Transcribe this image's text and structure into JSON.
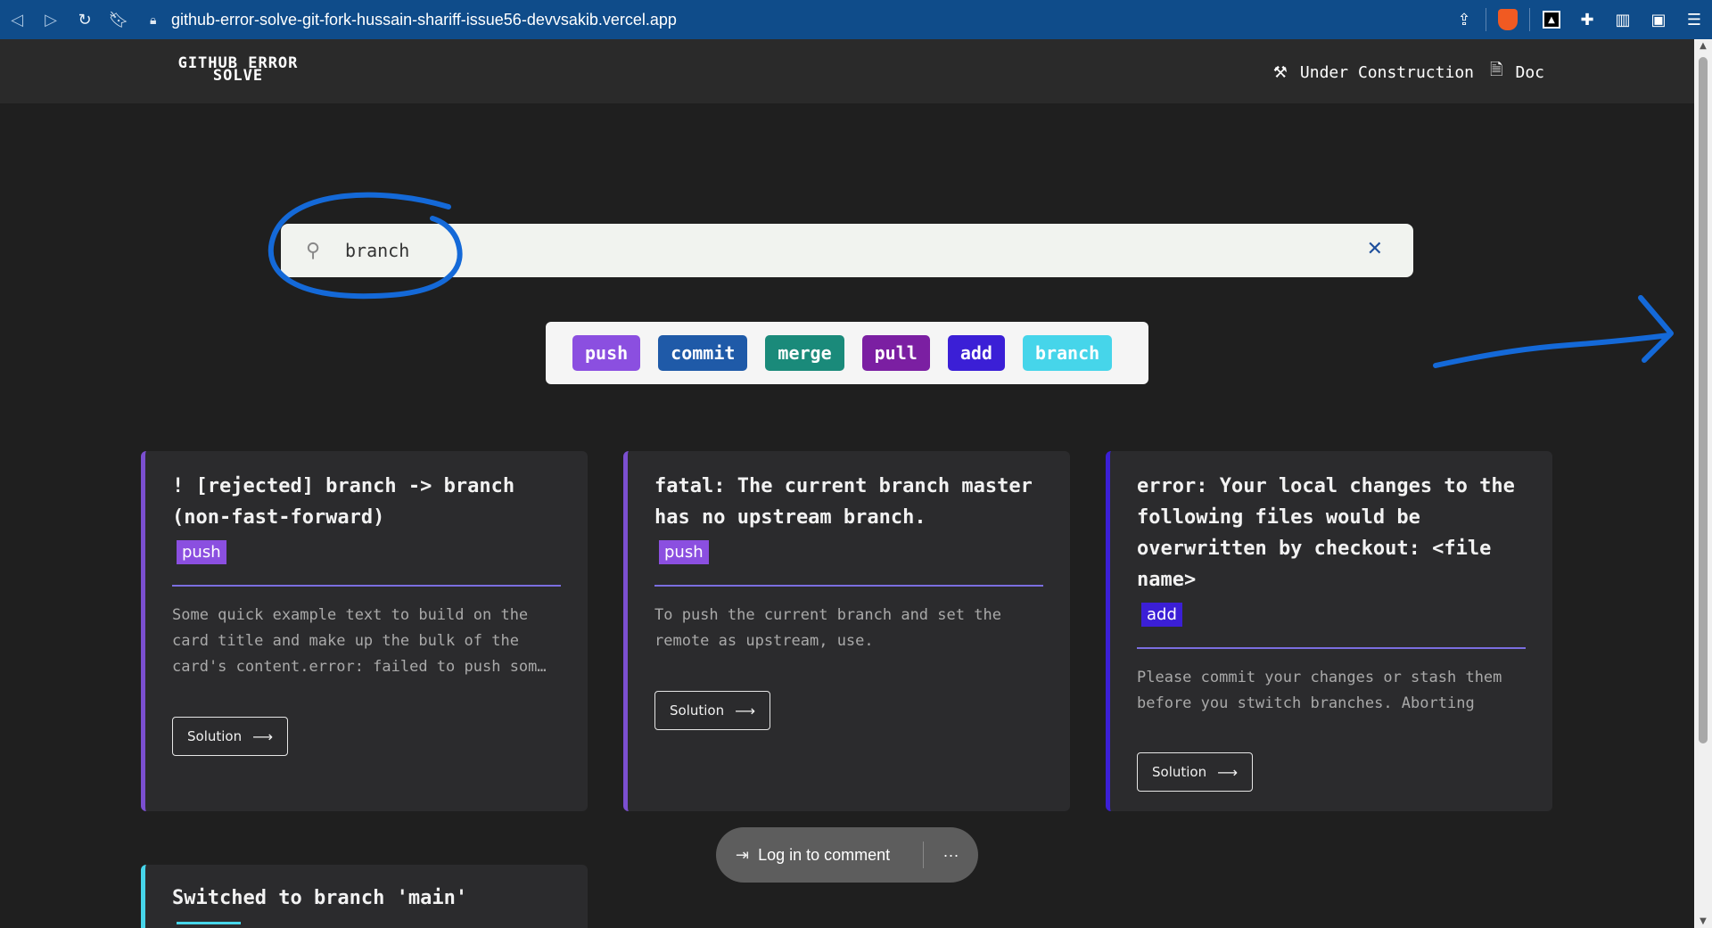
{
  "browser": {
    "url": "github-error-solve-git-fork-hussain-shariff-issue56-devvsakib.vercel.app"
  },
  "navbar": {
    "logo_line1": "GITHUB ERROR",
    "logo_line2": "SOLVE",
    "links": [
      {
        "label": "Under Construction",
        "icon": "tools-icon"
      },
      {
        "label": "Doc",
        "icon": "document-icon"
      }
    ]
  },
  "search": {
    "value": "branch",
    "placeholder": "Search"
  },
  "tags": [
    {
      "label": "push",
      "color": "#8b4fe0"
    },
    {
      "label": "commit",
      "color": "#1f5aa8"
    },
    {
      "label": "merge",
      "color": "#1a8a7a"
    },
    {
      "label": "pull",
      "color": "#7b1fa2"
    },
    {
      "label": "add",
      "color": "#3b1fd6"
    },
    {
      "label": "branch",
      "color": "#46d5ea"
    }
  ],
  "cards": [
    {
      "title": "! [rejected] branch -> branch (non-fast-forward)",
      "tag": "push",
      "description": "Some quick example text to build on the card title and make up the bulk of the card's content.error: failed to push som…",
      "button": "Solution",
      "accent": "#7b4fd0"
    },
    {
      "title": "fatal: The current branch master has no upstream branch.",
      "tag": "push",
      "description": "To push the current branch and set the remote as upstream, use.",
      "button": "Solution",
      "accent": "#7b4fd0"
    },
    {
      "title": "error: Your local changes to the following files would be overwritten by checkout: <file name>",
      "tag": "add",
      "description": "Please commit your changes or stash them before you stwitch branches. Aborting",
      "button": "Solution",
      "accent": "#3b1fd6"
    },
    {
      "title": "Switched to branch 'main'",
      "accent": "#46d5ea"
    }
  ],
  "comment": {
    "login_label": "Log in to comment",
    "more_label": "···"
  }
}
